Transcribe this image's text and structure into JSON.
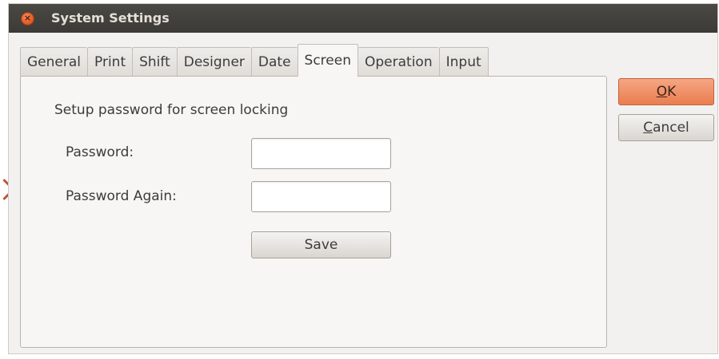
{
  "window": {
    "title": "System Settings",
    "close_symbol": "×"
  },
  "tabs": [
    {
      "label": "General",
      "active": false
    },
    {
      "label": "Print",
      "active": false
    },
    {
      "label": "Shift",
      "active": false
    },
    {
      "label": "Designer",
      "active": false
    },
    {
      "label": "Date",
      "active": false
    },
    {
      "label": "Screen",
      "active": true
    },
    {
      "label": "Operation",
      "active": false
    },
    {
      "label": "Input",
      "active": false
    }
  ],
  "screen_tab": {
    "heading": "Setup password for screen locking",
    "password_label": "Password:",
    "password_value": "",
    "password_again_label": "Password Again:",
    "password_again_value": "",
    "save_label": "Save"
  },
  "dialog_buttons": {
    "ok_mnemonic": "O",
    "ok_rest": "K",
    "cancel_mnemonic": "C",
    "cancel_rest": "ancel"
  },
  "colors": {
    "titlebar": "#3b3a36",
    "ok_button": "#ea7d50",
    "close_button": "#e0561f",
    "side_arrow": "#c0503a"
  },
  "icons": {
    "close": "close-icon",
    "side_arrow": "chevron-right-icon"
  }
}
